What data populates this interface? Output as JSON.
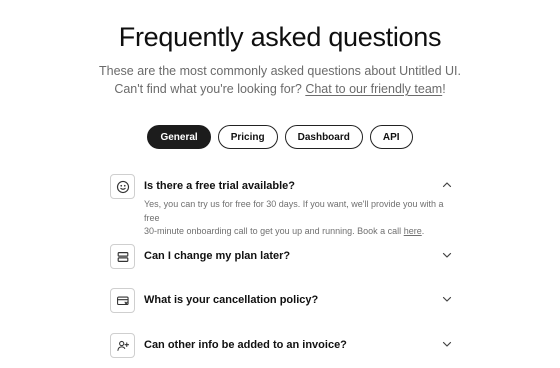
{
  "header": {
    "title": "Frequently asked questions",
    "subtitle_line1": "These are the most commonly asked questions about Untitled UI.",
    "subtitle_line2_prefix": "Can't find what you're looking for?",
    "subtitle_link": "Chat to our friendly team",
    "subtitle_suffix": "!"
  },
  "tabs": [
    {
      "label": "General",
      "active": true
    },
    {
      "label": "Pricing",
      "active": false
    },
    {
      "label": "Dashboard",
      "active": false
    },
    {
      "label": "API",
      "active": false
    }
  ],
  "faqs": [
    {
      "icon": "smiley-icon",
      "question": "Is there a free trial available?",
      "expanded": true,
      "answer_line1": "Yes, you can try us for free for 30 days. If you want, we'll provide you with a free",
      "answer_line2": "30-minute onboarding call to get you up and running. Book a call",
      "answer_link": "here",
      "answer_suffix": "."
    },
    {
      "icon": "layers-icon",
      "question": "Can I change my plan later?",
      "expanded": false
    },
    {
      "icon": "card-cancel-icon",
      "question": "What is your cancellation policy?",
      "expanded": false
    },
    {
      "icon": "user-plus-icon",
      "question": "Can other info be added to an invoice?",
      "expanded": false
    }
  ]
}
